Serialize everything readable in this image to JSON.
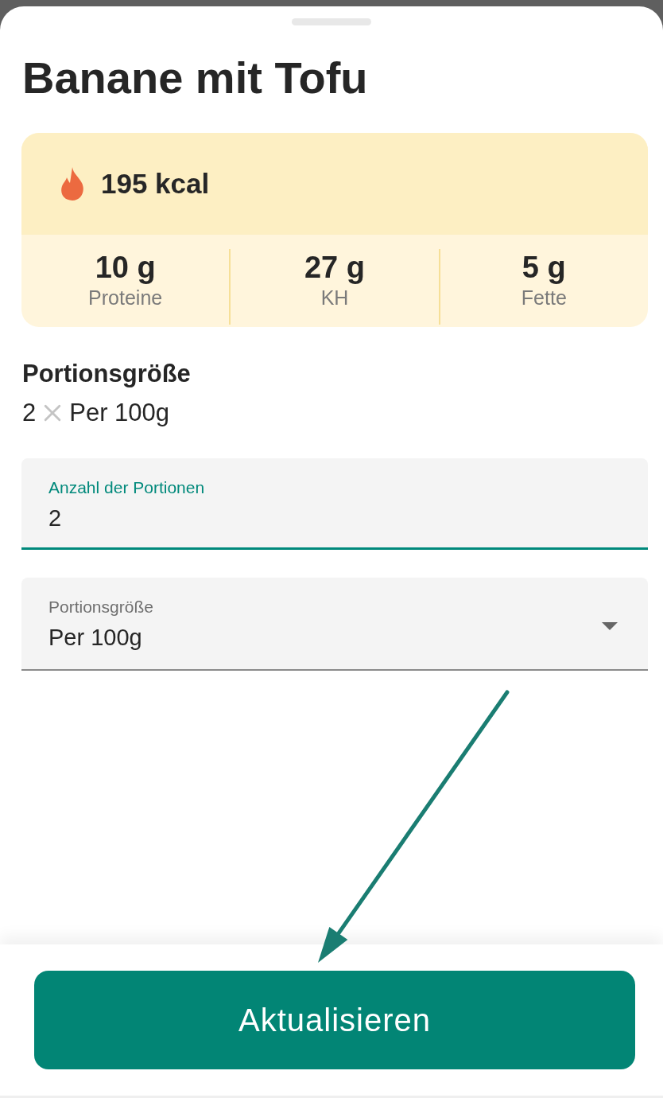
{
  "sheet": {
    "title": "Banane mit Tofu"
  },
  "nutrition": {
    "calories": "195 kcal",
    "macros": [
      {
        "value": "10 g",
        "label": "Proteine"
      },
      {
        "value": "27 g",
        "label": "KH"
      },
      {
        "value": "5 g",
        "label": "Fette"
      }
    ]
  },
  "serving": {
    "heading": "Portionsgröße",
    "count": "2",
    "unit": "Per 100g"
  },
  "fields": [
    {
      "kind": "text",
      "label": "Anzahl der Portionen",
      "value": "2",
      "focused": true
    },
    {
      "kind": "select",
      "label": "Portionsgröße",
      "value": "Per 100g",
      "focused": false
    }
  ],
  "primary_button": {
    "label": "Aktualisieren"
  }
}
